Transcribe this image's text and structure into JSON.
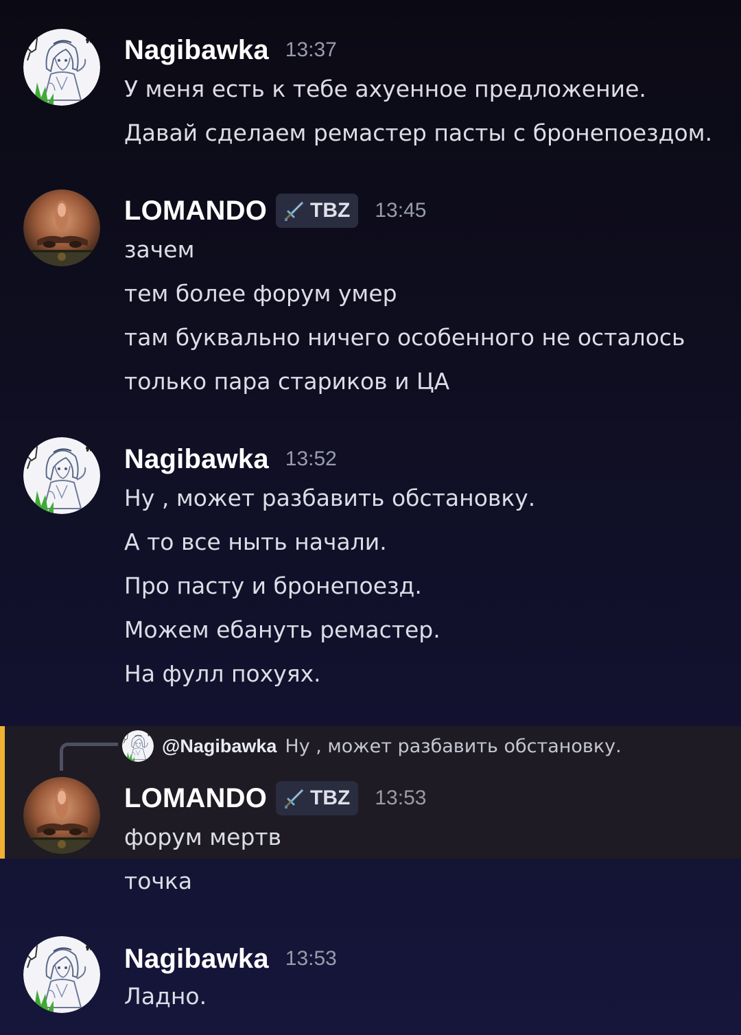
{
  "messages": [
    {
      "author": "Nagibawka",
      "time": "13:37",
      "lines": [
        "У меня есть к тебе ахуенное предложение.",
        "Давай сделаем ремастер пасты с бронепоездом."
      ]
    },
    {
      "author": "LOMANDO",
      "tag": "TBZ",
      "time": "13:45",
      "lines": [
        "зачем",
        "тем более форум умер",
        "там буквально ничего особенного не осталось",
        "только пара стариков и ЦА"
      ]
    },
    {
      "author": "Nagibawka",
      "time": "13:52",
      "lines": [
        "Ну , может разбавить обстановку.",
        "А то все ныть начали.",
        "Про пасту и бронепоезд.",
        "Можем ебануть ремастер.",
        "На фулл похуях."
      ]
    },
    {
      "author": "LOMANDO",
      "tag": "TBZ",
      "time": "13:53",
      "reply": {
        "author": "@Nagibawka",
        "text": "Ну , может разбавить обстановку."
      },
      "lines": [
        "форум мертв",
        "точка"
      ]
    },
    {
      "author": "Nagibawka",
      "time": "13:53",
      "lines": [
        "Ладно."
      ]
    }
  ],
  "colors": {
    "mention_highlight_bar": "#f0b232",
    "mention_highlight_bg": "#1e1b24",
    "username": "#ffffff",
    "timestamp": "#9a9cab"
  },
  "icons": {
    "avatar_nagibawka": "anime-maid-sketch-avatar",
    "avatar_lomando": "face-photo-avatar",
    "tag_icon": "sword-icon"
  }
}
